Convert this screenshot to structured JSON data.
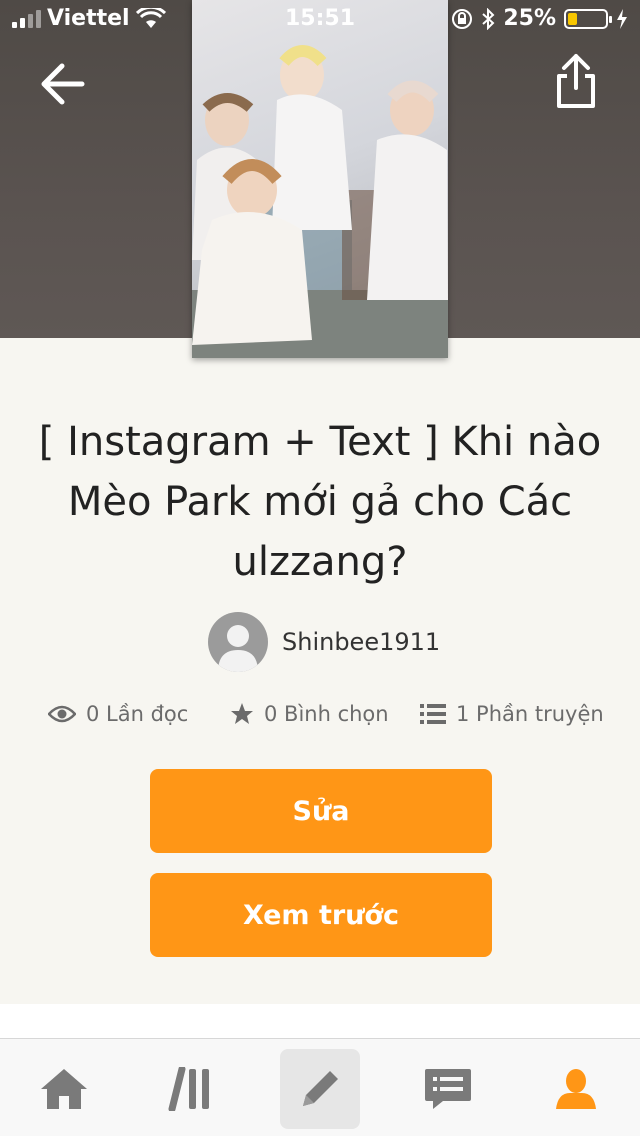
{
  "status_bar": {
    "carrier": "Viettel",
    "time": "15:51",
    "battery": "25%",
    "battery_level": 0.25
  },
  "story": {
    "title": "[ Instagram + Text ] Khi nào Mèo Park mới gả cho Các ulzzang?",
    "author": "Shinbee1911",
    "reads": "0 Lần đọc",
    "votes": "0 Bình chọn",
    "parts": "1 Phần truyện"
  },
  "actions": {
    "edit_label": "Sửa",
    "preview_label": "Xem trước"
  },
  "icons": {
    "back": "arrow-left-icon",
    "share": "share-icon",
    "reads": "eye-icon",
    "votes": "star-icon",
    "parts": "list-icon",
    "tab_home": "home-icon",
    "tab_library": "library-icon",
    "tab_write": "pencil-icon",
    "tab_messages": "chat-icon",
    "tab_profile": "profile-icon"
  },
  "colors": {
    "accent": "#ff9616",
    "header_bg": "#5a5350",
    "page_bg": "#f7f6f1",
    "icon_gray": "#6b6b6b"
  },
  "tabbar": {
    "active_tab": "write"
  }
}
